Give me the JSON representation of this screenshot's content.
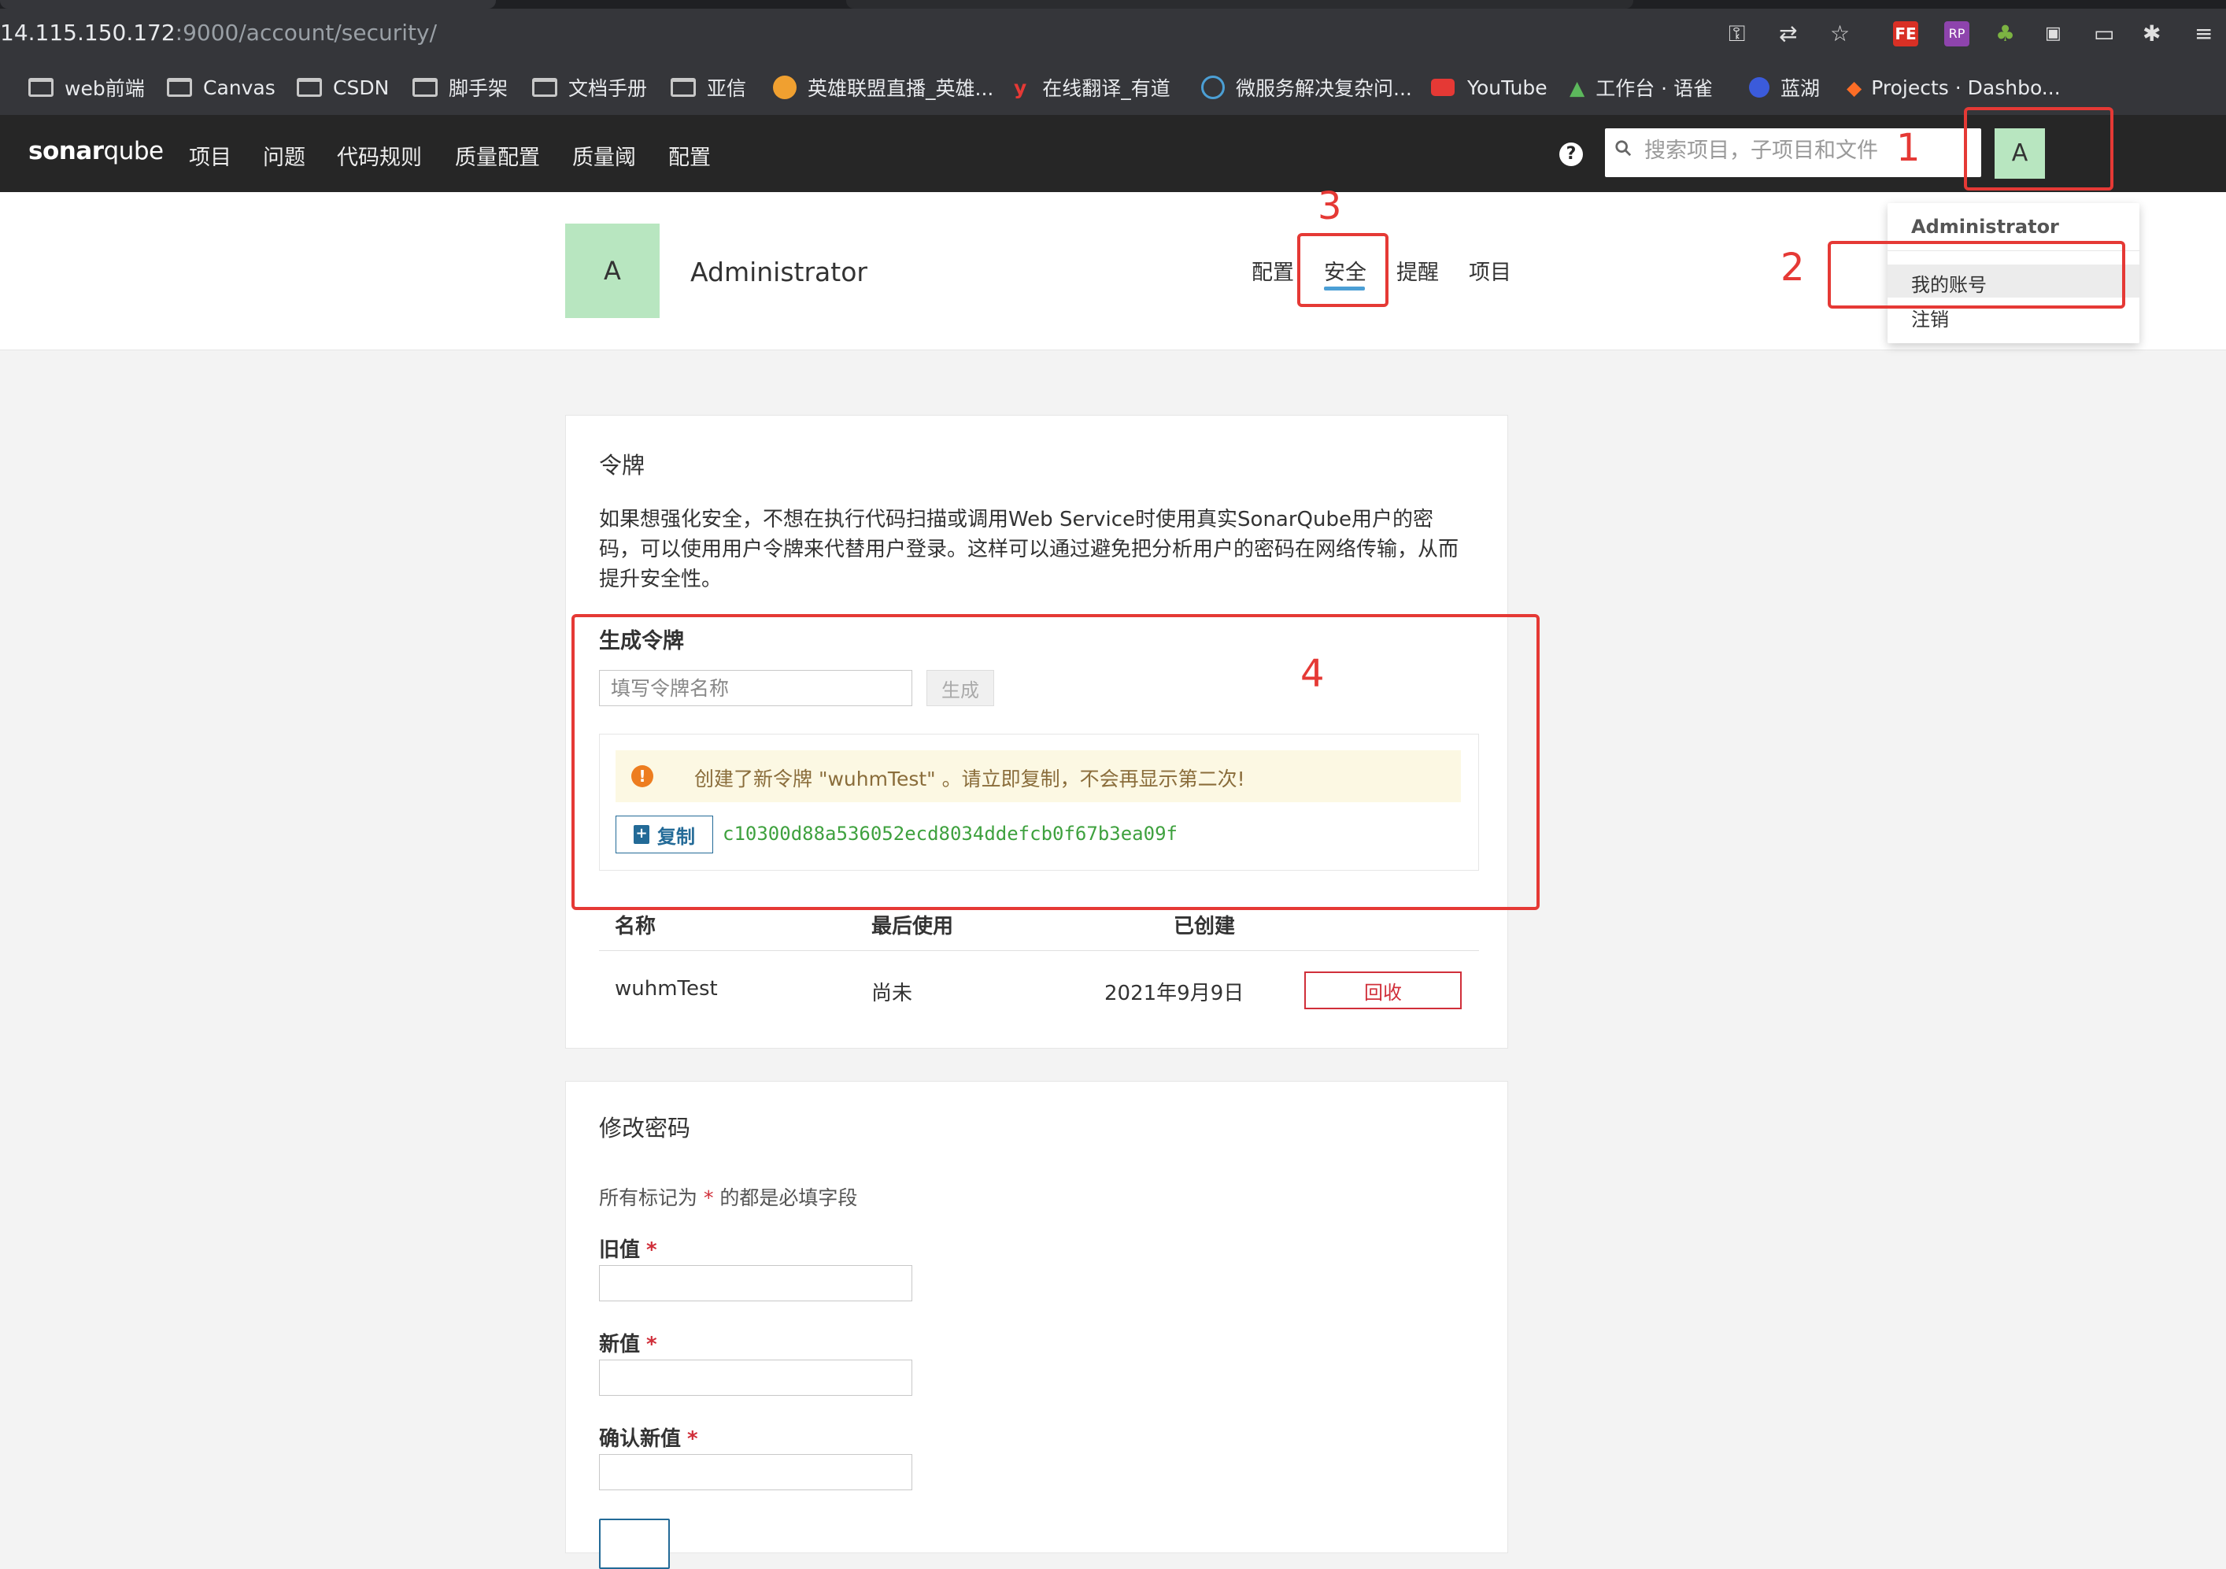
{
  "browser": {
    "url_host": "14.115.150.172",
    "url_rest": ":9000/account/security/",
    "bookmarks": [
      "web前端",
      "Canvas",
      "CSDN",
      "脚手架",
      "文档手册",
      "亚信",
      "英雄联盟直播_英雄...",
      "在线翻译_有道",
      "微服务解决复杂问...",
      "YouTube",
      "工作台 · 语雀",
      "蓝湖",
      "Projects · Dashbo..."
    ],
    "toolbar_icons": [
      "key-icon",
      "translate-icon",
      "star-icon",
      "fe-extension-icon",
      "rp-extension-icon",
      "plant-extension-icon",
      "qr-extension-icon",
      "chat-extension-icon",
      "puzzle-icon",
      "reading-list-icon"
    ],
    "ext_fe": "FE",
    "ext_rp": "RP"
  },
  "nav": {
    "logo_a": "sonar",
    "logo_b": "qube",
    "items": [
      "项目",
      "问题",
      "代码规则",
      "质量配置",
      "质量阈",
      "配置"
    ],
    "search_placeholder": "搜索项目，子项目和文件",
    "avatar": "A",
    "help": "?"
  },
  "profile": {
    "avatar": "A",
    "name": "Administrator",
    "tabs": [
      "配置",
      "安全",
      "提醒",
      "项目"
    ],
    "active_tab": "安全"
  },
  "dropdown": {
    "name": "Administrator",
    "my_account": "我的账号",
    "logout": "注销"
  },
  "tokens": {
    "title": "令牌",
    "description": "如果想强化安全，不想在执行代码扫描或调用Web Service时使用真实SonarQube用户的密码，可以使用用户令牌来代替用户登录。这样可以通过避免把分析用户的密码在网络传输，从而提升安全性。",
    "generate_title": "生成令牌",
    "name_placeholder": "填写令牌名称",
    "generate_button": "生成",
    "alert_text": "创建了新令牌 \"wuhmTest\" 。请立即复制，不会再显示第二次!",
    "copy_button": "复制",
    "token_value": "c10300d88a536052ecd8034ddefcb0f67b3ea09f",
    "columns": [
      "名称",
      "最后使用",
      "已创建"
    ],
    "rows": [
      {
        "name": "wuhmTest",
        "last_used": "尚未",
        "created": "2021年9月9日",
        "action": "回收"
      }
    ]
  },
  "password": {
    "title": "修改密码",
    "note_pre": "所有标记为",
    "note_star": "*",
    "note_post": "的都是必填字段",
    "old_label": "旧值",
    "new_label": "新值",
    "confirm_label": "确认新值",
    "required_mark": "*"
  },
  "annotations": {
    "color": "#e53935",
    "numbers": [
      "1",
      "2",
      "3",
      "4"
    ]
  },
  "colors": {
    "nav_bg": "#262626",
    "avatar_bg": "#b8e6c0",
    "accent_blue": "#4b9fd5",
    "danger": "#d02f3a",
    "token_green": "#3ea13e",
    "alert_bg": "#fcf8e3"
  }
}
